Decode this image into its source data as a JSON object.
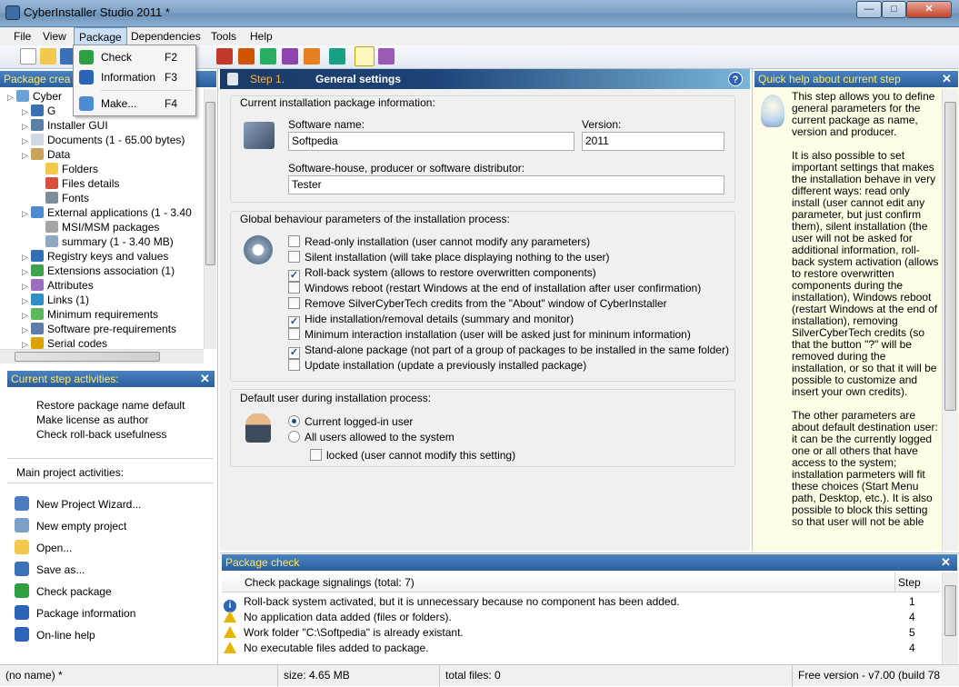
{
  "window": {
    "title": "CyberInstaller Studio 2011 *",
    "min": "—",
    "max": "□",
    "close": "✕"
  },
  "menubar": {
    "items": [
      "File",
      "View",
      "Package",
      "Dependencies",
      "Tools",
      "Help"
    ]
  },
  "package_menu": [
    {
      "label": "Check",
      "shortcut": "F2",
      "icon": "check-icon"
    },
    {
      "label": "Information",
      "shortcut": "F3",
      "icon": "info-icon"
    },
    {
      "label": "Make...",
      "shortcut": "F4",
      "icon": "make-icon"
    }
  ],
  "left": {
    "tree_header": "Package crea",
    "tree": [
      {
        "label": "Cyber",
        "level": 0,
        "icon": "cd-icon"
      },
      {
        "label": "G",
        "level": 1,
        "icon": "general-icon"
      },
      {
        "label": "Installer GUI",
        "level": 1,
        "icon": "gui-icon"
      },
      {
        "label": "Documents (1 - 65.00 bytes)",
        "level": 1,
        "icon": "documents-icon"
      },
      {
        "label": "Data",
        "level": 1,
        "icon": "data-icon"
      },
      {
        "label": "Folders",
        "level": 2,
        "icon": "folder-icon"
      },
      {
        "label": "Files details",
        "level": 2,
        "icon": "files-icon"
      },
      {
        "label": "Fonts",
        "level": 2,
        "icon": "font-icon"
      },
      {
        "label": "External applications (1 - 3.40",
        "level": 1,
        "icon": "apps-icon"
      },
      {
        "label": "MSI/MSM packages",
        "level": 2,
        "icon": "msi-icon"
      },
      {
        "label": "summary (1 - 3.40 MB)",
        "level": 2,
        "icon": "summary-icon"
      },
      {
        "label": "Registry keys and values",
        "level": 1,
        "icon": "registry-icon"
      },
      {
        "label": "Extensions association (1)",
        "level": 1,
        "icon": "extensions-icon"
      },
      {
        "label": "Attributes",
        "level": 1,
        "icon": "attributes-icon"
      },
      {
        "label": "Links (1)",
        "level": 1,
        "icon": "links-icon"
      },
      {
        "label": "Minimum requirements",
        "level": 1,
        "icon": "requirements-icon"
      },
      {
        "label": "Software pre-requirements",
        "level": 1,
        "icon": "prereq-icon"
      },
      {
        "label": "Serial codes",
        "level": 1,
        "icon": "key-icon"
      }
    ],
    "activities_header": "Current step activities:",
    "step_activities": [
      "Restore package name default",
      "Make license as author",
      "Check roll-back usefulness"
    ],
    "main_activities_label": "Main project activities:",
    "main_activities": [
      {
        "label": "New Project Wizard...",
        "icon": "wizard-icon"
      },
      {
        "label": "New empty project",
        "icon": "new-project-icon"
      },
      {
        "label": "Open...",
        "icon": "open-icon"
      },
      {
        "label": "Save as...",
        "icon": "save-icon"
      },
      {
        "label": "Check package",
        "icon": "check-icon"
      },
      {
        "label": "Package information",
        "icon": "info-icon"
      },
      {
        "label": "On-line help",
        "icon": "help-icon"
      }
    ]
  },
  "step": {
    "number": "Step 1.",
    "title": "General settings",
    "help": "?"
  },
  "info_group": {
    "title": "Current installation package information:",
    "software_name_label": "Software name:",
    "software_name": "Softpedia",
    "version_label": "Version:",
    "version": "2011",
    "producer_label": "Software-house, producer or software distributor:",
    "producer": "Tester"
  },
  "behaviour_group": {
    "title": "Global behaviour parameters of the installation process:",
    "options": [
      {
        "label": "Read-only installation (user cannot modify any parameters)",
        "checked": false
      },
      {
        "label": "Silent installation (will take place displaying nothing to the user)",
        "checked": false
      },
      {
        "label": "Roll-back system (allows to restore overwritten components)",
        "checked": true
      },
      {
        "label": "Windows reboot (restart Windows at the end of installation after user confirmation)",
        "checked": false
      },
      {
        "label": "Remove SilverCyberTech credits from the \"About\" window of CyberInstaller",
        "checked": false
      },
      {
        "label": "Hide installation/removal details (summary and monitor)",
        "checked": true
      },
      {
        "label": "Minimum interaction installation (user will be asked just for mininum information)",
        "checked": false
      },
      {
        "label": "Stand-alone package (not part of a group of packages to be installed in the same folder)",
        "checked": true
      },
      {
        "label": "Update installation (update a previously installed package)",
        "checked": false
      }
    ]
  },
  "user_group": {
    "title": "Default user during installation process:",
    "radio_current": "Current logged-in user",
    "radio_all": "All users allowed to the system",
    "locked": "locked (user cannot modify this setting)",
    "selected": "current"
  },
  "help": {
    "header": "Quick help about current step",
    "paragraphs": [
      "This step allows you to define general parameters for the current package as name, version and producer.",
      "It is also possible to set important settings that makes the installation behave in very different ways: read only install (user cannot edit any parameter, but just confirm them), silent installation (the user will not be asked for additional information, roll-back system activation (allows to restore overwritten components during the installation), Windows reboot (restart Windows at the end of installation), removing SilverCyberTech credits (so that the button \"?\" will be removed during the installation, or so that it will be possible to customize and insert your own credits).",
      "The other parameters are about default destination user: it can be the currently logged one or all others that have access to the system; installation parmeters will fit these choices (Start Menu path, Desktop, etc.). It is also possible to block this setting so that user will not be able"
    ]
  },
  "check": {
    "header": "Package check",
    "col_signal": "Check package signalings (total: 7)",
    "col_step": "Step",
    "rows": [
      {
        "type": "info",
        "text": "Roll-back system activated, but it is unnecessary because no component has been added.",
        "step": "1"
      },
      {
        "type": "warning",
        "text": "No application data added (files or folders).",
        "step": "4"
      },
      {
        "type": "warning",
        "text": "Work folder \"C:\\Softpedia\" is already existant.",
        "step": "5"
      },
      {
        "type": "warning",
        "text": "No executable files added to package.",
        "step": "4"
      }
    ]
  },
  "status": {
    "name": "(no name) *",
    "size": "size: 4.65 MB",
    "files": "total files: 0",
    "version": "Free version - v7.00 (build 78"
  },
  "colors": {
    "panel_header": "#2c5f9c",
    "header_text": "#ffeb6b",
    "help_bg": "#fffde6",
    "warning": "#e7b400"
  }
}
